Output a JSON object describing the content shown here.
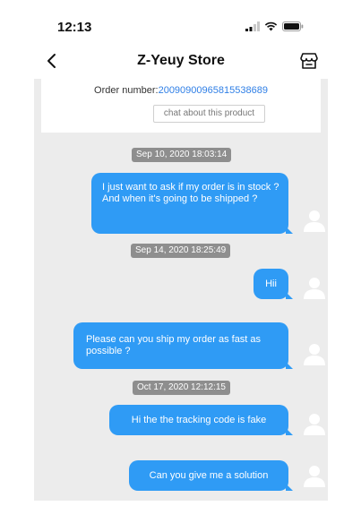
{
  "status_bar": {
    "time": "12:13",
    "icons": [
      "signal-icon",
      "wifi-icon",
      "battery-icon"
    ]
  },
  "header": {
    "back_icon": "chevron-left-icon",
    "title": "Z-Yeuy Store",
    "store_icon": "store-icon"
  },
  "order": {
    "label": "Order number:",
    "number": "20090900965815538689",
    "chat_button": "chat about this product"
  },
  "conversation": [
    {
      "type": "timestamp",
      "text": "Sep 10, 2020 18:03:14"
    },
    {
      "type": "message",
      "text": "I just want to ask if my order is in stock ? And when it's going to be shipped ?"
    },
    {
      "type": "timestamp",
      "text": "Sep 14, 2020 18:25:49"
    },
    {
      "type": "message",
      "text": "Hii"
    },
    {
      "type": "message",
      "text": "Please can you ship my order as fast as possible ?"
    },
    {
      "type": "timestamp",
      "text": "Oct 17, 2020 12:12:15"
    },
    {
      "type": "message",
      "text": "Hi the the tracking code is fake"
    },
    {
      "type": "message",
      "text": "Can you give me a solution"
    }
  ],
  "colors": {
    "bubble": "#2f9bf5",
    "chat_background": "#ececec",
    "timestamp_background": "#8e8e8e",
    "link": "#2f7fe6",
    "avatar": "#ffffff"
  }
}
